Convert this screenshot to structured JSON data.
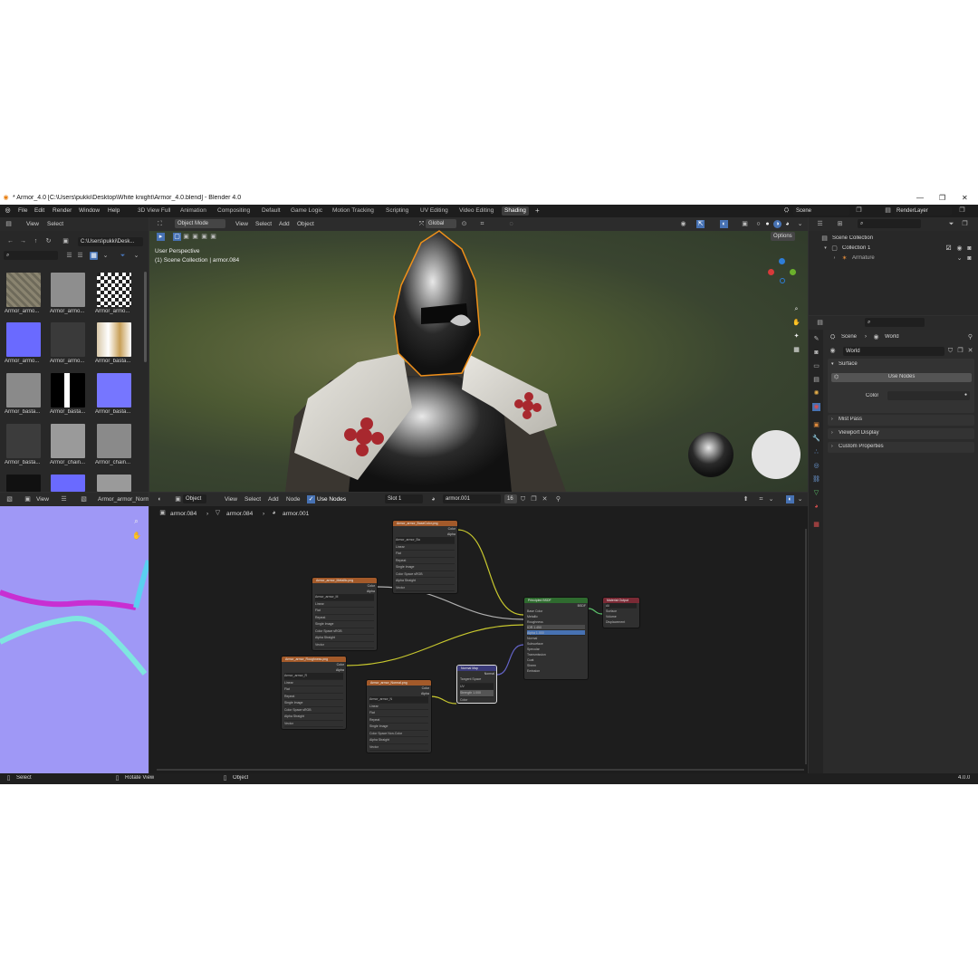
{
  "window": {
    "title": "* Armor_4.0 [C:\\Users\\pukki\\Desktop\\White knight\\Armor_4.0.blend] - Blender 4.0",
    "minimize": "—",
    "maximize": "❐",
    "close": "✕"
  },
  "menu": [
    "File",
    "Edit",
    "Render",
    "Window",
    "Help"
  ],
  "workspaces": [
    "3D View Full",
    "Animation",
    "Compositing",
    "Default",
    "Game Logic",
    "Motion Tracking",
    "Scripting",
    "UV Editing",
    "Video Editing",
    "Shading"
  ],
  "active_workspace": "Shading",
  "scene": "Scene",
  "render_layer": "RenderLayer",
  "file_browser": {
    "menu": [
      "View",
      "Select"
    ],
    "path": "C:\\Users\\pukki\\Desk...",
    "files": [
      "Armor_armo...",
      "Armor_armo...",
      "Armor_armo...",
      "Armor_armo...",
      "Armor_armo...",
      "Armor_basta...",
      "Armor_basta...",
      "Armor_basta...",
      "Armor_basta...",
      "Armor_basta...",
      "Armor_chain...",
      "Armor_chain..."
    ]
  },
  "viewport": {
    "mode": "Object Mode",
    "menu": [
      "View",
      "Select",
      "Add",
      "Object"
    ],
    "transform": "Global",
    "options": "Options",
    "perspective": "User Perspective",
    "collection_info": "(1) Scene Collection | armor.084"
  },
  "outliner": {
    "scene_collection": "Scene Collection",
    "collection": "Collection 1",
    "armature": "Armature"
  },
  "properties": {
    "breadcrumb_scene": "Scene",
    "breadcrumb_world": "World",
    "world_name": "World",
    "surface": "Surface",
    "use_nodes": "Use Nodes",
    "color": "Color",
    "mist_pass": "Mist Pass",
    "viewport_display": "Viewport Display",
    "custom_properties": "Custom Properties"
  },
  "image_editor": {
    "view": "View",
    "image_name": "Armor_armor_Norm"
  },
  "node_editor": {
    "object": "Object",
    "menu": [
      "View",
      "Select",
      "Add",
      "Node"
    ],
    "use_nodes": "Use Nodes",
    "slot": "Slot 1",
    "material": "armor.001",
    "users": "16",
    "breadcrumb": [
      "armor.084",
      "armor.084",
      "armor.001"
    ]
  },
  "nodes": {
    "basecolor": {
      "title": "Armor_armor_BaseColor.png",
      "image": "Armor_armor_Ba",
      "rows": [
        "Linear",
        "Flat",
        "Repeat",
        "Single Image",
        "Color Space   sRGB",
        "Alpha   Straight",
        "Vector"
      ]
    },
    "metallic": {
      "title": "Armor_armor_Metallic.png",
      "image": "Armor_armor_M",
      "rows": [
        "Linear",
        "Flat",
        "Repeat",
        "Single Image",
        "Color Space   sRGB",
        "Alpha   Straight",
        "Vector"
      ]
    },
    "roughness": {
      "title": "Armor_armor_Roughness.png",
      "image": "Armor_armor_R",
      "rows": [
        "Linear",
        "Flat",
        "Repeat",
        "Single Image",
        "Color Space   sRGB",
        "Alpha   Straight",
        "Vector"
      ]
    },
    "normal": {
      "title": "Armor_armor_Normal.png",
      "image": "Armor_armor_N",
      "rows": [
        "Linear",
        "Flat",
        "Repeat",
        "Single Image",
        "Color Space   Non-Color",
        "Alpha   Straight",
        "Vector"
      ]
    },
    "normalmap": {
      "title": "Normal Map",
      "rows": [
        "Normal",
        "Tangent Space",
        "UV",
        "Strength   1.000",
        "Color"
      ]
    },
    "bsdf": {
      "title": "Principled BSDF",
      "rows": [
        "BSDF",
        "Base Color",
        "Metallic",
        "Roughness",
        "IOR   1.450",
        "Alpha   1.000",
        "Normal",
        "Subsurface",
        "Specular",
        "Transmission",
        "Coat",
        "Sheen",
        "Emission"
      ]
    },
    "output": {
      "title": "Material Output",
      "rows": [
        "All",
        "Surface",
        "Volume",
        "Displacement"
      ]
    },
    "socket_color": "Color",
    "socket_alpha": "Alpha"
  },
  "status": {
    "select": "Select",
    "rotate": "Rotate View",
    "object": "Object",
    "version": "4.0.0"
  },
  "colors": {
    "image_node_header": "#a35a2a",
    "bsdf_header": "#2f6b2f",
    "output_header": "#7a2a35",
    "vector_header": "#3b3b7a",
    "link_yellow": "#c7c72e",
    "link_grey": "#a0a0a0",
    "link_purple": "#6464c8",
    "accent_blue": "#4772b3"
  }
}
